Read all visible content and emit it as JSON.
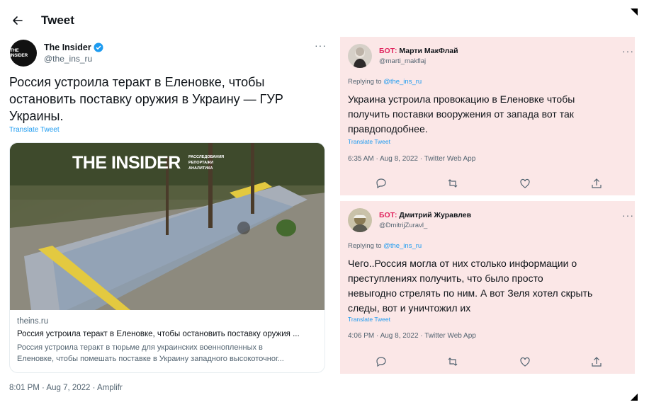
{
  "main_tweet": {
    "header_title": "Tweet",
    "logo_text": "THE INSIDER",
    "author_name": "The Insider",
    "author_handle": "@the_ins_ru",
    "text": "Россия устроила теракт в Еленовке, чтобы остановить поставку оружия в Украину — ГУР Украины.",
    "translate_label": "Translate Tweet",
    "card": {
      "brand": "THE INSIDER",
      "brand_tagline": [
        "РАССЛЕДОВАНИЯ",
        "РЕПОРТАЖИ",
        "АНАЛИТИКА"
      ],
      "domain": "theins.ru",
      "title": "Россия устроила теракт в Еленовке, чтобы остановить поставку оружия ...",
      "description_line1": "Россия устроила теракт в тюрьме для украинских военнопленных в",
      "description_line2": "Еленовке, чтобы помешать поставке в Украину западного высокоточног..."
    },
    "timestamp": "8:01 PM · Aug 7, 2022 · Amplifr"
  },
  "replies": [
    {
      "bot_label": "БОТ:",
      "name": "Марти МакФлай",
      "handle": "@marti_makflaj",
      "replying_prefix": "Replying to",
      "replying_to": "@the_ins_ru",
      "text_line1": "Украина устроила провокацию в Еленовке чтобы",
      "text_line2": "получить поставки вооружения от запада вот так",
      "text_line3": "правдоподобнее.",
      "translate_label": "Translate Tweet",
      "timestamp": "6:35 AM · Aug 8, 2022 · Twitter Web App"
    },
    {
      "bot_label": "БОТ:",
      "name": "Дмитрий Журавлев",
      "handle": "@DmitrijZuravl_",
      "replying_prefix": "Replying to",
      "replying_to": "@the_ins_ru",
      "text_line1": "Чего..Россия могла от них столько информации о",
      "text_line2": "преступлениях получить, что было просто",
      "text_line3": "невыгодно стрелять по ним. А вот Зеля хотел скрыть",
      "text_line4": "следы, вот и уничтожил их",
      "translate_label": "Translate Tweet",
      "timestamp": "4:06 PM · Aug 8, 2022 · Twitter Web App"
    }
  ],
  "more_glyph": "···",
  "colors": {
    "accent": "#1d9bf0",
    "bot": "#e0245e",
    "reply_bg": "#fbe7e7"
  },
  "icons": [
    "back-arrow-icon",
    "verified-badge-icon",
    "more-icon",
    "reply-icon",
    "retweet-icon",
    "like-icon",
    "share-icon"
  ]
}
